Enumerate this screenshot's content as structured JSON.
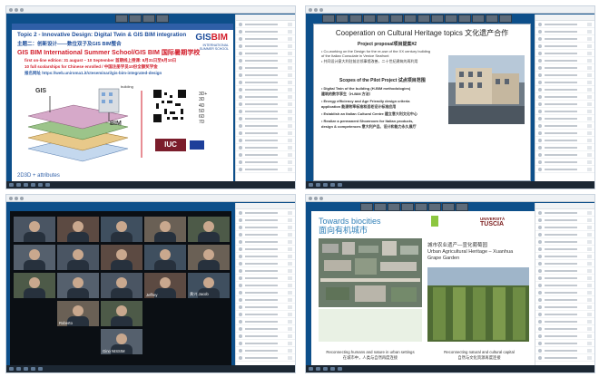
{
  "panel1": {
    "slide": {
      "topic": "Topic 2 - Innovative Design: Digital Twin & GIS BIM integration",
      "topic_cn": "主题二：创新设计——数位双子及GIS BIM整合",
      "headline": "GIS BIM International Summer School/GIS BIM 国际暑期学校",
      "bullets": [
        "first on-line edition: 31 august – 10 September 首期线上授课: 8月31日至9月10日",
        "10 full scolarships for Chinese enrolled / 中国注册学员10份全额奖学金",
        "报名网址 https://web.uniroma1.it/cteseminari/gis-bim-integrated-design"
      ],
      "logo_main": "GIS",
      "logo_accent": "BIM",
      "logo_sub": "INTERNATIONAL SUMMER SCHOOL",
      "side_list": [
        "3D+",
        "3D",
        "4D",
        "5D",
        "6D",
        "7D"
      ],
      "gis_label": "GIS",
      "bim_label": "BIM",
      "building_label": "building",
      "footer": "2D3D + attributes",
      "iuc": "IUC"
    }
  },
  "panel2": {
    "slide": {
      "title": "Cooperation on Cultural Heritage topics 文化遗产合作",
      "project_heading": "Project proposal项目提案#2",
      "project_lines": [
        "• Co-working on the Design for the re-use of the XX century building",
        "  of the Italian Consulate in Venice Seafront",
        "• 共同设计意大利驻前总领事馆改善，二十世纪建筑的再利用"
      ],
      "scope_heading": "Scopes of the Pilot Project 试点项目范围",
      "scope_lines": [
        "• Digital Twin of the building (H-BIM methodologies)",
        "  建筑的数字孪生（H-BIM 方法）",
        "• Energy efficiency and Age Friendly design criteria",
        "  application 能源效率标准和适老设计标准应用",
        "• Establish an Italian Cultural Centre 建立意大利文化中心",
        "• Realize a permanent Showroom for Italian products,",
        "  design & competences 意大利产品、设计和能力永久展厅"
      ]
    }
  },
  "panel3": {
    "participants": [
      {
        "name": ""
      },
      {
        "name": ""
      },
      {
        "name": ""
      },
      {
        "name": ""
      },
      {
        "name": ""
      },
      {
        "name": ""
      },
      {
        "name": ""
      },
      {
        "name": ""
      },
      {
        "name": ""
      },
      {
        "name": ""
      },
      {
        "name": ""
      },
      {
        "name": ""
      },
      {
        "name": ""
      },
      {
        "name": "Jeffrey"
      },
      {
        "name": "黄兴 Jacob"
      },
      {
        "name": "Roberto"
      },
      {
        "name": ""
      },
      {
        "name": "Gino NISSIM"
      }
    ]
  },
  "panel4": {
    "slide": {
      "title_en": "Towards biocities",
      "title_cn": "面向有机城市",
      "univ_top": "UNIVERSITÀ",
      "univ_name": "TUSCIA",
      "heading_cn": "城市农业遗产—宣化葡萄园",
      "heading_en": "Urban Agricultural Heritage – Xuanhua Grape Garden",
      "cap_left_en": "Reconnecting humans and nature in urban settings",
      "cap_left_cn": "在城市中，人类与自然再度连接",
      "cap_right_en": "Reconnecting natural and cultural capital",
      "cap_right_cn": "自然与文化资源再度连接"
    }
  },
  "colors": {
    "dark_blue": "#0d4f8a",
    "slide_blue": "#1d4d9a",
    "red": "#d21e2b",
    "tuscia": "#7a1a1a",
    "biocities": "#2f7fb7"
  }
}
